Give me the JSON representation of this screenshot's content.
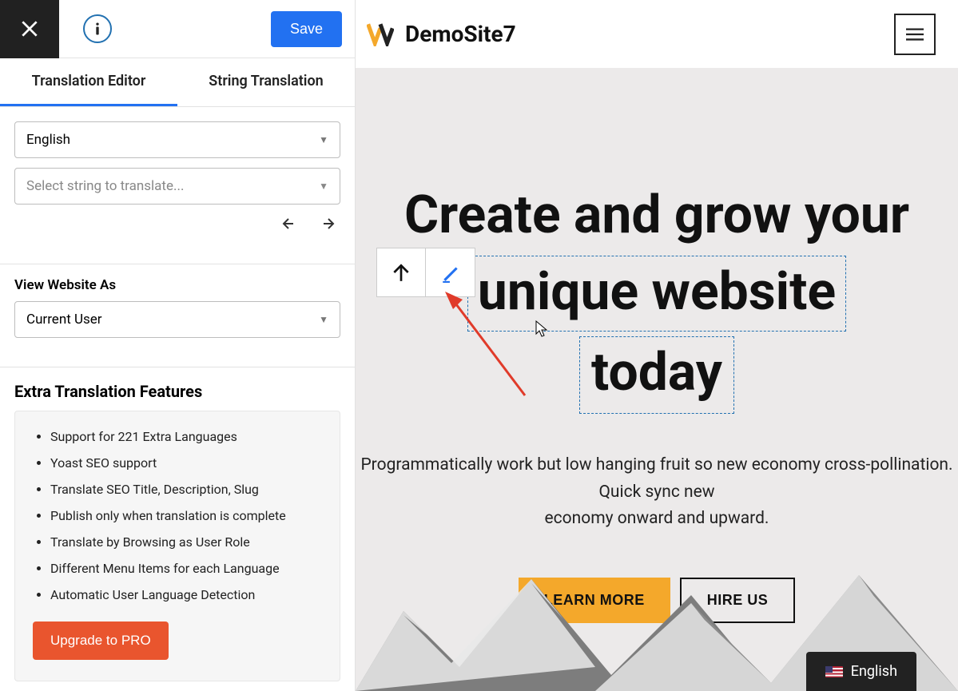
{
  "sidebar": {
    "save_label": "Save",
    "tabs": {
      "editor": "Translation Editor",
      "string": "String Translation"
    },
    "lang_select": "English",
    "string_select_placeholder": "Select string to translate...",
    "view_as_label": "View Website As",
    "view_as_value": "Current User",
    "features_heading": "Extra Translation Features",
    "features": [
      "Support for 221 Extra Languages",
      "Yoast SEO support",
      "Translate SEO Title, Description, Slug",
      "Publish only when translation is complete",
      "Translate by Browsing as User Role",
      "Different Menu Items for each Language",
      "Automatic User Language Detection"
    ],
    "upgrade_label": "Upgrade to PRO"
  },
  "preview": {
    "site_title": "DemoSite7",
    "hero": {
      "line1": "Create and grow your",
      "line2": "unique website",
      "line3": "today"
    },
    "subtitle_line1": "Programmatically work but low hanging fruit so new economy cross-pollination. Quick sync new",
    "subtitle_line2": "economy onward and upward.",
    "cta_primary": "LEARN MORE",
    "cta_secondary": "HIRE US",
    "lang_switcher": "English"
  },
  "colors": {
    "accent_blue": "#2271f1",
    "accent_orange": "#f4a82b",
    "upgrade_red": "#e9552e"
  }
}
